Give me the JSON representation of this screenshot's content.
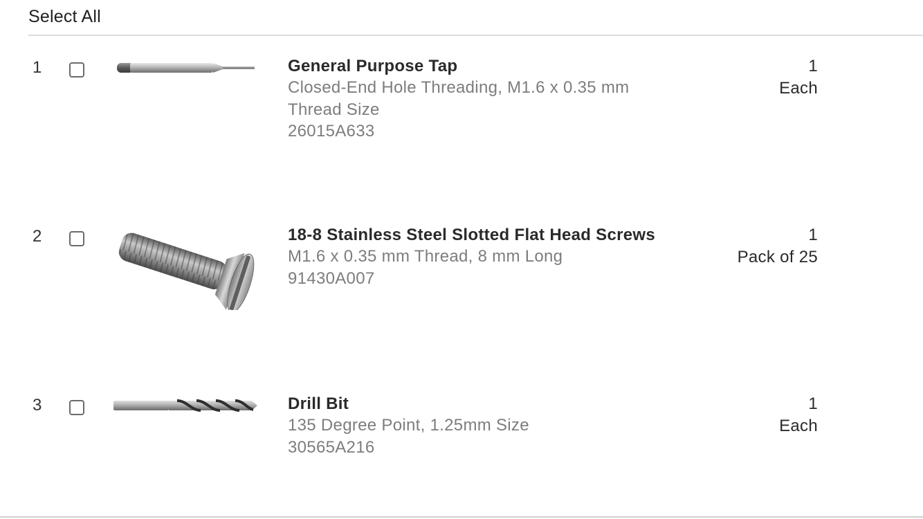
{
  "header": {
    "select_all_label": "Select All"
  },
  "items": [
    {
      "index": "1",
      "icon": "tap-image",
      "title": "General Purpose Tap",
      "description": "Closed-End Hole Threading, M1.6 x 0.35 mm Thread Size",
      "part_number": "26015A633",
      "quantity": "1",
      "unit": "Each"
    },
    {
      "index": "2",
      "icon": "screw-image",
      "title": "18-8 Stainless Steel Slotted Flat Head Screws",
      "description": "M1.6 x 0.35 mm Thread, 8 mm Long",
      "part_number": "91430A007",
      "quantity": "1",
      "unit": "Pack of 25"
    },
    {
      "index": "3",
      "icon": "drill-bit-image",
      "title": "Drill Bit",
      "description": "135 Degree Point, 1.25mm Size",
      "part_number": "30565A216",
      "quantity": "1",
      "unit": "Each"
    }
  ]
}
